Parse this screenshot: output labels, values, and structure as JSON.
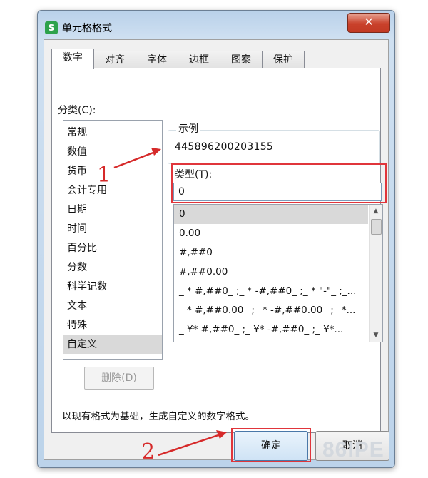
{
  "window": {
    "title": "单元格格式",
    "close_label": "✕",
    "app_icon": "S"
  },
  "tabs": [
    "数字",
    "对齐",
    "字体",
    "边框",
    "图案",
    "保护"
  ],
  "category": {
    "label": "分类(C):",
    "items": [
      "常规",
      "数值",
      "货币",
      "会计专用",
      "日期",
      "时间",
      "百分比",
      "分数",
      "科学记数",
      "文本",
      "特殊",
      "自定义"
    ],
    "selected": "自定义"
  },
  "sample": {
    "label": "示例",
    "value": "445896200203155"
  },
  "type_field": {
    "label": "类型(T):",
    "value": "0"
  },
  "format_list": {
    "items": [
      "0",
      "0.00",
      "#,##0",
      "#,##0.00",
      "_ * #,##0_ ;_ * -#,##0_ ;_ * \"-\"_ ;_...",
      "_ * #,##0.00_ ;_ * -#,##0.00_ ;_ *...",
      "_ ¥* #,##0_ ;_ ¥* -#,##0_ ;_ ¥*..."
    ],
    "selected": "0"
  },
  "buttons": {
    "delete": "删除(D)",
    "ok": "确定",
    "cancel": "取消"
  },
  "description": "以现有格式为基础，生成自定义的数字格式。",
  "annotations": {
    "step1": "1",
    "step2": "2"
  },
  "watermark": "86IPE",
  "colors": {
    "highlight_red": "#e0353b",
    "selected_row": "#d9d9d9",
    "icon_green": "#2da24b"
  }
}
